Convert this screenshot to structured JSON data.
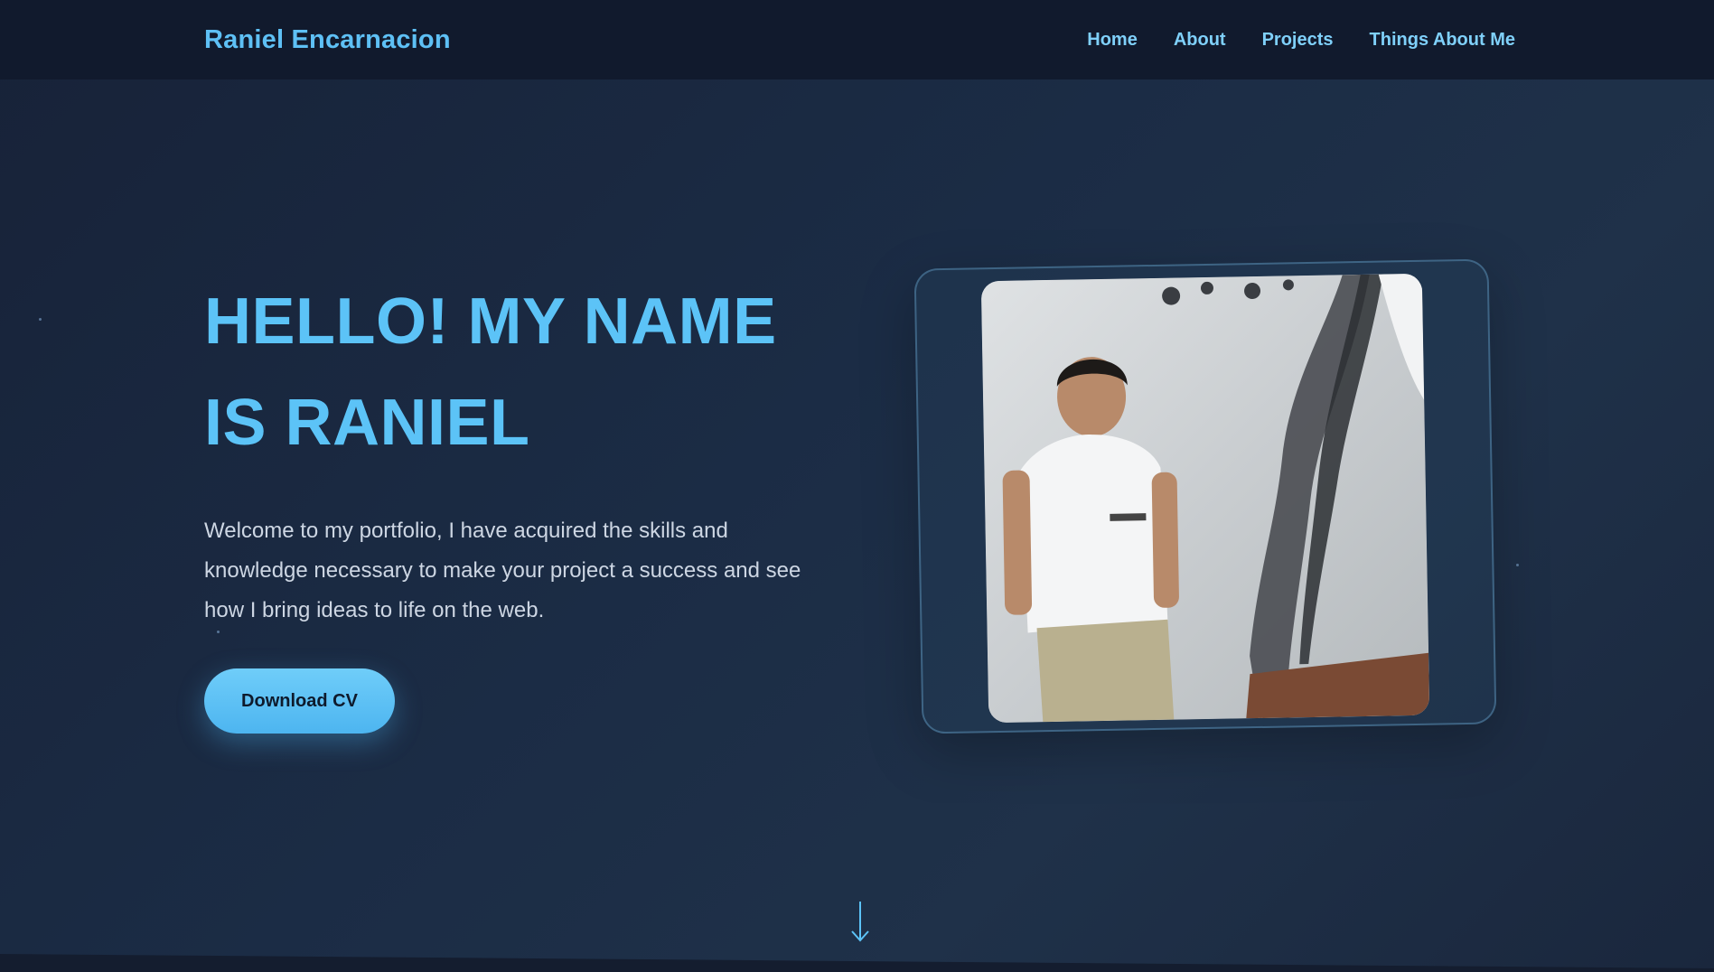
{
  "header": {
    "brand": "Raniel Encarnacion",
    "nav": [
      {
        "label": "Home"
      },
      {
        "label": "About"
      },
      {
        "label": "Projects"
      },
      {
        "label": "Things About Me"
      }
    ]
  },
  "hero": {
    "title_line1": "HELLO! MY NAME",
    "title_line2": "IS RANIEL",
    "description": "Welcome to my portfolio, I have acquired the skills and knowledge necessary to make your project a success and see how I bring ideas to life on the web.",
    "cv_button_label": "Download CV"
  },
  "icons": {
    "scroll": "arrow-down-icon"
  },
  "colors": {
    "accent": "#5cc3f7",
    "nav_bg": "#111a2d",
    "text_muted": "#cdd6e3",
    "button_dark_text": "#0e1a2c"
  }
}
